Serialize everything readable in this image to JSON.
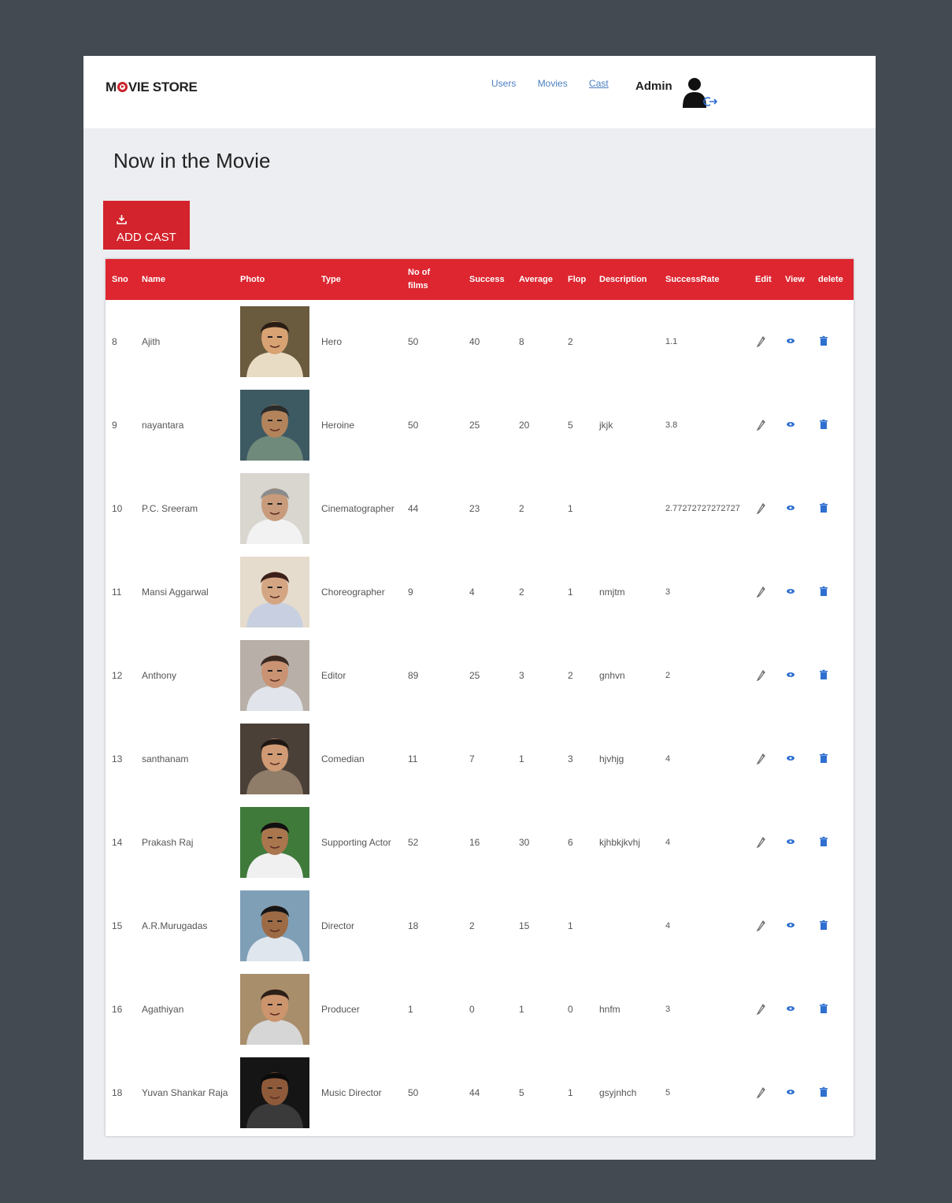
{
  "brand": {
    "name_prefix": "M",
    "name_suffix": "VIE STORE"
  },
  "nav": {
    "users": "Users",
    "movies": "Movies",
    "cast": "Cast"
  },
  "user": {
    "name": "Admin"
  },
  "page": {
    "title": "Now in the Movie"
  },
  "actions": {
    "add_cast": "ADD CAST"
  },
  "colors": {
    "accent": "#d3232c",
    "link": "#4a7fc1",
    "frame_bg": "#444a52",
    "page_bg": "#eceef1"
  },
  "table": {
    "headers": {
      "sno": "Sno",
      "name": "Name",
      "photo": "Photo",
      "type": "Type",
      "films": "No of films",
      "success": "Success",
      "average": "Average",
      "flop": "Flop",
      "description": "Description",
      "successrate": "SuccessRate",
      "edit": "Edit",
      "view": "View",
      "delete": "delete"
    },
    "rows": [
      {
        "sno": "8",
        "name": "Ajith",
        "type": "Hero",
        "films": "50",
        "success": "40",
        "average": "8",
        "flop": "2",
        "description": "",
        "successrate": "1.1"
      },
      {
        "sno": "9",
        "name": "nayantara",
        "type": "Heroine",
        "films": "50",
        "success": "25",
        "average": "20",
        "flop": "5",
        "description": "jkjk",
        "successrate": "3.8"
      },
      {
        "sno": "10",
        "name": "P.C. Sreeram",
        "type": "Cinematographer",
        "films": "44",
        "success": "23",
        "average": "2",
        "flop": "1",
        "description": "",
        "successrate": "2.77272727272727"
      },
      {
        "sno": "11",
        "name": "Mansi Aggarwal",
        "type": "Choreographer",
        "films": "9",
        "success": "4",
        "average": "2",
        "flop": "1",
        "description": "nmjtm",
        "successrate": "3"
      },
      {
        "sno": "12",
        "name": "Anthony",
        "type": "Editor",
        "films": "89",
        "success": "25",
        "average": "3",
        "flop": "2",
        "description": "gnhvn",
        "successrate": "2"
      },
      {
        "sno": "13",
        "name": "santhanam",
        "type": "Comedian",
        "films": "11",
        "success": "7",
        "average": "1",
        "flop": "3",
        "description": "hjvhjg",
        "successrate": "4"
      },
      {
        "sno": "14",
        "name": "Prakash Raj",
        "type": "Supporting Actor",
        "films": "52",
        "success": "16",
        "average": "30",
        "flop": "6",
        "description": "kjhbkjkvhj",
        "successrate": "4"
      },
      {
        "sno": "15",
        "name": "A.R.Murugadas",
        "type": "Director",
        "films": "18",
        "success": "2",
        "average": "15",
        "flop": "1",
        "description": "",
        "successrate": "4"
      },
      {
        "sno": "16",
        "name": "Agathiyan",
        "type": "Producer",
        "films": "1",
        "success": "0",
        "average": "1",
        "flop": "0",
        "description": "hnfm",
        "successrate": "3"
      },
      {
        "sno": "18",
        "name": "Yuvan Shankar Raja",
        "type": "Music Director",
        "films": "50",
        "success": "44",
        "average": "5",
        "flop": "1",
        "description": "gsyjnhch",
        "successrate": "5"
      }
    ]
  }
}
